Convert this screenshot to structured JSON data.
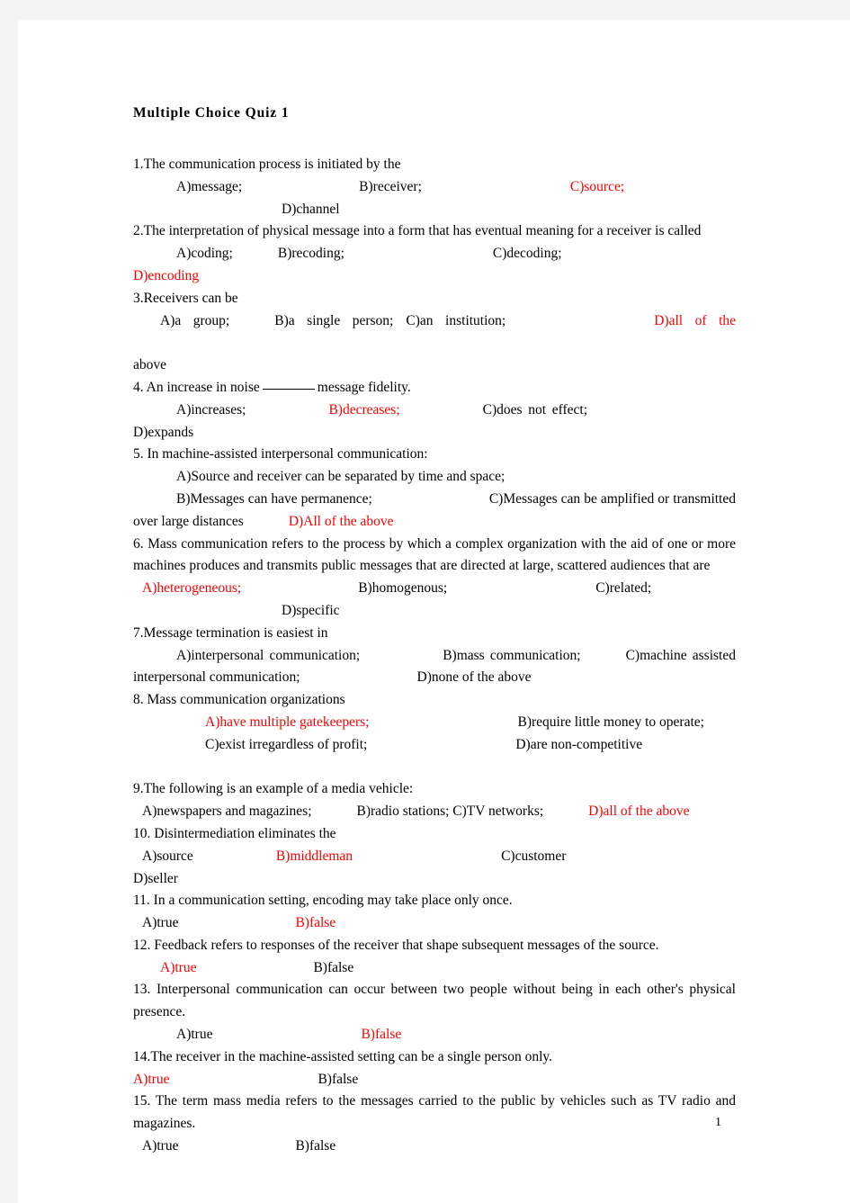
{
  "document": {
    "title": "Multiple Choice Quiz 1",
    "page_number": "1",
    "accent_color": "#ff0000",
    "text_color": "#000000",
    "page_background": "#ffffff",
    "canvas_background": "#f4f4f4"
  },
  "questions": [
    {
      "number": "1.",
      "stem": "1.The communication process is initiated by the",
      "options": [
        {
          "label": "A)message;",
          "correct": false
        },
        {
          "label": "B)receiver;",
          "correct": false
        },
        {
          "label": "C)source;",
          "correct": true
        },
        {
          "label": "D)channel",
          "correct": false
        }
      ]
    },
    {
      "number": "2.",
      "stem": "2.The interpretation of physical message into a form that has  eventual meaning for a receiver is called",
      "options": [
        {
          "label": "A)coding;",
          "correct": false
        },
        {
          "label": "B)recoding;",
          "correct": false
        },
        {
          "label": "C)decoding;",
          "correct": false
        },
        {
          "label": "D)encoding",
          "correct": true
        }
      ]
    },
    {
      "number": "3.",
      "stem": "3.Receivers can be",
      "options": [
        {
          "label": "A)a group;",
          "correct": false
        },
        {
          "label": "B)a single person;",
          "correct": false
        },
        {
          "label": "C)an institution;",
          "correct": false
        },
        {
          "label": "D)all of the",
          "correct": true
        },
        {
          "label": "above",
          "correct": false
        }
      ]
    },
    {
      "number": "4.",
      "stem_before_blank": "4. An increase in noise",
      "stem_after_blank": "message fidelity.",
      "options": [
        {
          "label": "A)increases;",
          "correct": false
        },
        {
          "label": "B)decreases;",
          "correct": true
        },
        {
          "label": "C)does not effect;",
          "correct": false
        },
        {
          "label": "D)expands",
          "correct": false
        }
      ]
    },
    {
      "number": "5.",
      "stem": "5. In machine-assisted interpersonal communication:",
      "options": [
        {
          "label": "A)Source and receiver can be separated by time and space;",
          "correct": false
        },
        {
          "label": "B)Messages can have permanence;",
          "correct": false
        },
        {
          "label": "C)Messages can be amplified or transmitted over large distances",
          "correct": false
        },
        {
          "label": "D)All of the above",
          "correct": true
        }
      ]
    },
    {
      "number": "6.",
      "stem": "6. Mass communication refers to the process by which a complex organization with the aid of one or more machines produces and  transmits public messages that are directed at large, scattered   audiences that are",
      "options": [
        {
          "label": "A)heterogeneous;",
          "correct": true
        },
        {
          "label": "B)homogenous;",
          "correct": false
        },
        {
          "label": "C)related;",
          "correct": false
        },
        {
          "label": "D)specific",
          "correct": false
        }
      ]
    },
    {
      "number": "7.",
      "stem": "7.Message termination is easiest in",
      "options": [
        {
          "label": "A)interpersonal communication;",
          "correct": false
        },
        {
          "label": "B)mass communication;",
          "correct": false
        },
        {
          "label": "C)machine assisted interpersonal communication;",
          "correct": false
        },
        {
          "label": "D)none of the above",
          "correct": false
        }
      ]
    },
    {
      "number": "8.",
      "stem": "8. Mass communication organizations",
      "options": [
        {
          "label": "A)have multiple gatekeepers;",
          "correct": true
        },
        {
          "label": "B)require little money to operate;",
          "correct": false
        },
        {
          "label": "C)exist irregardless of profit;",
          "correct": false
        },
        {
          "label": "D)are non-competitive",
          "correct": false
        }
      ]
    },
    {
      "number": "9.",
      "stem": "9.The following is an example of a media vehicle:",
      "options": [
        {
          "label": "A)newspapers and magazines;",
          "correct": false
        },
        {
          "label": "B)radio stations; C)TV networks;",
          "correct": false
        },
        {
          "label": "D)all of the above",
          "correct": true
        }
      ]
    },
    {
      "number": "10.",
      "stem": "10. Disintermediation eliminates the",
      "options": [
        {
          "label": "A)source",
          "correct": false
        },
        {
          "label": "B)middleman",
          "correct": true
        },
        {
          "label": "C)customer",
          "correct": false
        },
        {
          "label": "D)seller",
          "correct": false
        }
      ]
    },
    {
      "number": "11.",
      "stem": "11. In a communication setting, encoding may take place only   once.",
      "options": [
        {
          "label": "A)true",
          "correct": false
        },
        {
          "label": "B)false",
          "correct": true
        }
      ]
    },
    {
      "number": "12.",
      "stem": "12. Feedback refers to responses of the receiver that shape subsequent messages of the source.",
      "options": [
        {
          "label": "A)true",
          "correct": true
        },
        {
          "label": "B)false",
          "correct": false
        }
      ]
    },
    {
      "number": "13.",
      "stem": "13. Interpersonal communication can occur between two people   without being in each other's physical presence.",
      "options": [
        {
          "label": "A)true",
          "correct": false
        },
        {
          "label": "B)false",
          "correct": true
        }
      ]
    },
    {
      "number": "14.",
      "stem": "14.The receiver in the machine-assisted setting can be a single person only.",
      "options": [
        {
          "label": "A)true",
          "correct": true
        },
        {
          "label": "B)false",
          "correct": false
        }
      ]
    },
    {
      "number": "15.",
      "stem": "15. The term mass media refers to the messages carried to the public by vehicles such as TV radio and magazines.",
      "options": [
        {
          "label": "A)true",
          "correct": false
        },
        {
          "label": "B)false",
          "correct": false
        }
      ]
    }
  ]
}
